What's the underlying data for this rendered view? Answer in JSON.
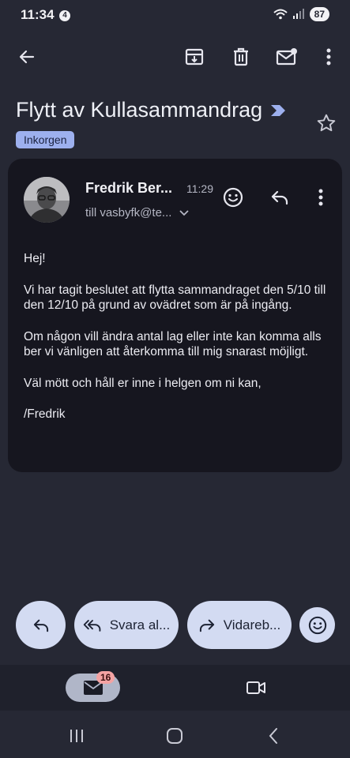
{
  "status_bar": {
    "time": "11:34",
    "notification_count": "4",
    "battery": "87"
  },
  "toolbar": {
    "back_icon": "arrow-left-icon",
    "archive_icon": "archive-icon",
    "delete_icon": "trash-icon",
    "mark_unread_icon": "mail-unread-icon",
    "more_icon": "more-vertical-icon"
  },
  "email": {
    "subject": "Flytt av Kullasammandrag",
    "label": "Inkorgen",
    "sender": "Fredrik Ber...",
    "time": "11:29",
    "recipient": "till vasbyfk@te...",
    "body": [
      "Hej!",
      "Vi har tagit beslutet att flytta sammandraget den 5/10 till den 12/10 på grund av ovädret som är på ingång.",
      "Om någon vill ändra antal lag eller inte kan komma alls ber vi vänligen att återkomma till mig snarast möjligt.",
      "Väl mött och håll er inne i helgen om ni kan,",
      "/Fredrik"
    ]
  },
  "actions": {
    "reply_all_label": "Svara al...",
    "forward_label": "Vidareb..."
  },
  "bottom_nav": {
    "mail_badge": "16"
  },
  "colors": {
    "background": "#262834",
    "card": "#16161f",
    "button": "#d3dbf2",
    "label_chip": "#9db0ee",
    "importance": "#9db0ee",
    "badge": "#f4a3a3"
  }
}
